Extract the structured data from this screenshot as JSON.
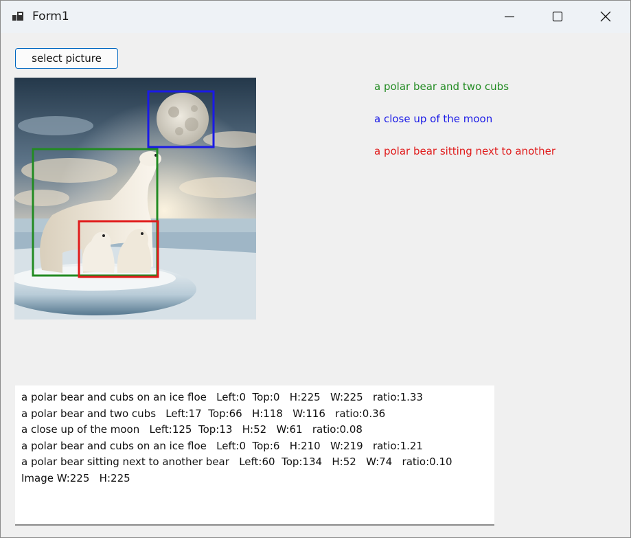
{
  "window": {
    "title": "Form1",
    "controls": {
      "minimize_icon": "minimize-icon",
      "maximize_icon": "maximize-icon",
      "close_icon": "close-icon"
    }
  },
  "toolbar": {
    "select_label": "select picture"
  },
  "captions": [
    {
      "text": "a polar bear and two cubs",
      "color": "#228b22"
    },
    {
      "text": "a close up of the moon",
      "color": "#1a1ae6"
    },
    {
      "text": "a polar bear sitting next to another",
      "color": "#e01b1b"
    }
  ],
  "bounding_box_colors": {
    "cubs_group": "#228b22",
    "moon": "#1a1ae6",
    "bear_sitting": "#e01b1b"
  },
  "output": {
    "lines": [
      "a polar bear and cubs on an ice floe   Left:0  Top:0   H:225   W:225   ratio:1.33",
      "a polar bear and two cubs   Left:17  Top:66   H:118   W:116   ratio:0.36",
      "a close up of the moon   Left:125  Top:13   H:52   W:61   ratio:0.08",
      "a polar bear and cubs on an ice floe   Left:0  Top:6   H:210   W:219   ratio:1.21",
      "a polar bear sitting next to another bear   Left:60  Top:134   H:52   W:74   ratio:0.10",
      "Image W:225   H:225"
    ]
  }
}
